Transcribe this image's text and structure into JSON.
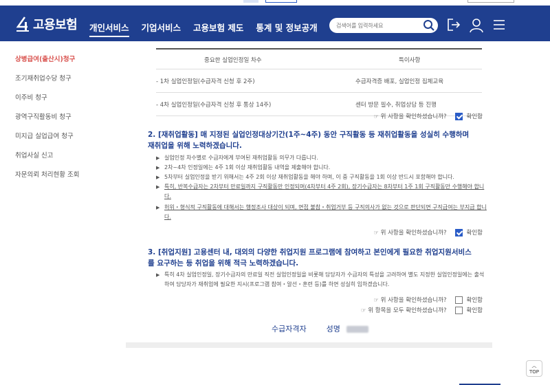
{
  "header": {
    "logo_text": "고용보험",
    "nav": [
      {
        "label": "개인서비스",
        "active": true
      },
      {
        "label": "기업서비스",
        "active": false
      },
      {
        "label": "고용보험 제도",
        "active": false
      },
      {
        "label": "통계 및 정보공개",
        "active": false
      }
    ],
    "search_placeholder": "검색어를 입력하세요",
    "icons": [
      "search-icon",
      "logout-icon",
      "user-icon",
      "menu-icon"
    ]
  },
  "sidebar": {
    "items": [
      {
        "label": "상병급여(출산시)청구",
        "active": true
      },
      {
        "label": "조기재취업수당 청구",
        "active": false
      },
      {
        "label": "이주비 청구",
        "active": false
      },
      {
        "label": "광역구직활동비 청구",
        "active": false
      },
      {
        "label": "미지급 실업급여 청구",
        "active": false
      },
      {
        "label": "취업사실 신고",
        "active": false
      },
      {
        "label": "자문의뢰 처리현황 조회",
        "active": false
      }
    ]
  },
  "content": {
    "table": {
      "headers": [
        "중요한 실업인정일 차수",
        "특이사항"
      ],
      "rows": [
        [
          "- 1차 실업인정일(수급자격 신청 후 2주)",
          "수급자격증 배포, 실업인정 집체교육"
        ],
        [
          "- 4차 실업인정일(수급자격 신청 후 통상 14주)",
          "센터 방문 필수, 취업상담 등 진행"
        ]
      ]
    },
    "confirm_q": "☞ 위 사항을 확인하셨습니까?",
    "confirm_all_q": "☞ 위 항목을 모두 확인하셨습니까?",
    "confirm_label": "확인함",
    "section2": {
      "title": "2. [재취업활동] 매 지정된 실업인정대상기간(1주~4주) 동안 구직활동 등 재취업활동을 성실히 수행하며 재취업을 위해 노력하겠습니다.",
      "bullets": [
        "실업인정 차수별로 수급자에게 부여된 재취업활동 의무가 다릅니다.",
        "2차~4차 인정일에는 4주 1회 이상 재취업활동 내역을 제출해야 합니다.",
        "5차부터 실업인정을 받기 위해서는 4주 2회 이상 재취업활동을 해야 하며, 이 중 구직활동을 1회 이상 반드시 포함해야 합니다.",
        "특히, 반복수급자는 2차부터 만료일까지 구직활동만 인정되며(4차부터 4주 2회), 장기수급자는 8차부터 1주 1회 구직활동만 수행해야 합니다.",
        "허위・형식적 구직활동에 대해서는 행정조사 대상이 되며, 면접 불참・취업거부 등 구직의사가 없는 것으로 판단되면 구직급여는 부지급 합니다."
      ]
    },
    "section3": {
      "title": "3. [취업지원] 고용센터 내, 대외의 다양한 취업지원 프로그램에 참여하고 본인에게 필요한 취업지원서비스를 요구하는 등 취업을 위해 적극 노력하겠습니다.",
      "bullets": [
        "특히 4차 실업인정일, 장기수급자의 만료일 직전 실업인정일을 비롯해 담당자가 수급자의 특성을 고려하여 별도 지정한 실업인정일에는 출석하여 담당자가 재취업에 필요한 지시(프로그램 참여・알선・훈련 등)를 하면 성실히 임하겠습니다."
      ]
    },
    "signature": {
      "role": "수급자격자",
      "name_label": "성명"
    }
  },
  "top_button": "TOP",
  "checks": {
    "confirm1": true,
    "confirm2": true,
    "confirm3": false,
    "confirm_all": false
  }
}
